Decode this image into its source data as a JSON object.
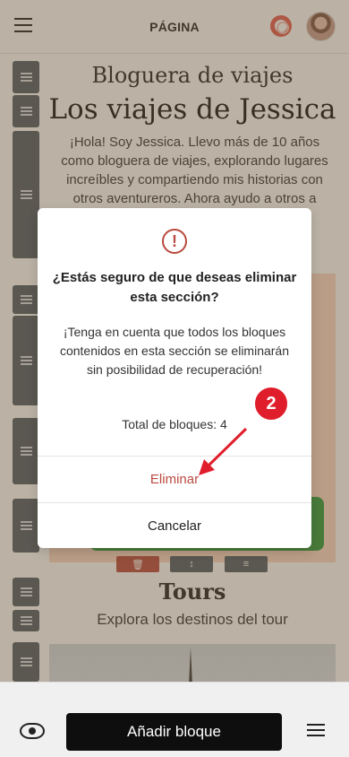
{
  "header": {
    "title": "PÁGINA"
  },
  "content": {
    "subtitle": "Bloguera de viajes",
    "title": "Los viajes de Jessica",
    "intro": "¡Hola! Soy Jessica. Llevo más de 10 años como bloguera de viajes, explorando lugares increíbles y compartiendo mis historias con otros aventureros. Ahora ayudo a otros a",
    "tours_title": "Tours",
    "tours_subtitle": "Explora los destinos del tour"
  },
  "modal": {
    "title": "¿Estás seguro de que deseas eliminar esta sección?",
    "body": "¡Tenga en cuenta que todos los bloques contenidos en esta sección se eliminarán sin posibilidad de recuperación!",
    "count_text": "Total de bloques: 4",
    "delete_label": "Eliminar",
    "cancel_label": "Cancelar",
    "warning_glyph": "!"
  },
  "annotation": {
    "step": "2"
  },
  "bottom_bar": {
    "add_block_label": "Añadir bloque"
  },
  "colors": {
    "danger": "#b94a3f",
    "badge": "#e01e2b",
    "accent_green": "#2e9b3c"
  },
  "icons": {
    "menu": "hamburger-icon",
    "help": "lifebuoy-icon",
    "preview": "eye-icon",
    "settings": "sliders-icon",
    "drag": "drag-handle-icon",
    "trash": "trash-icon",
    "move": "move-icon",
    "warning": "warning-icon"
  }
}
